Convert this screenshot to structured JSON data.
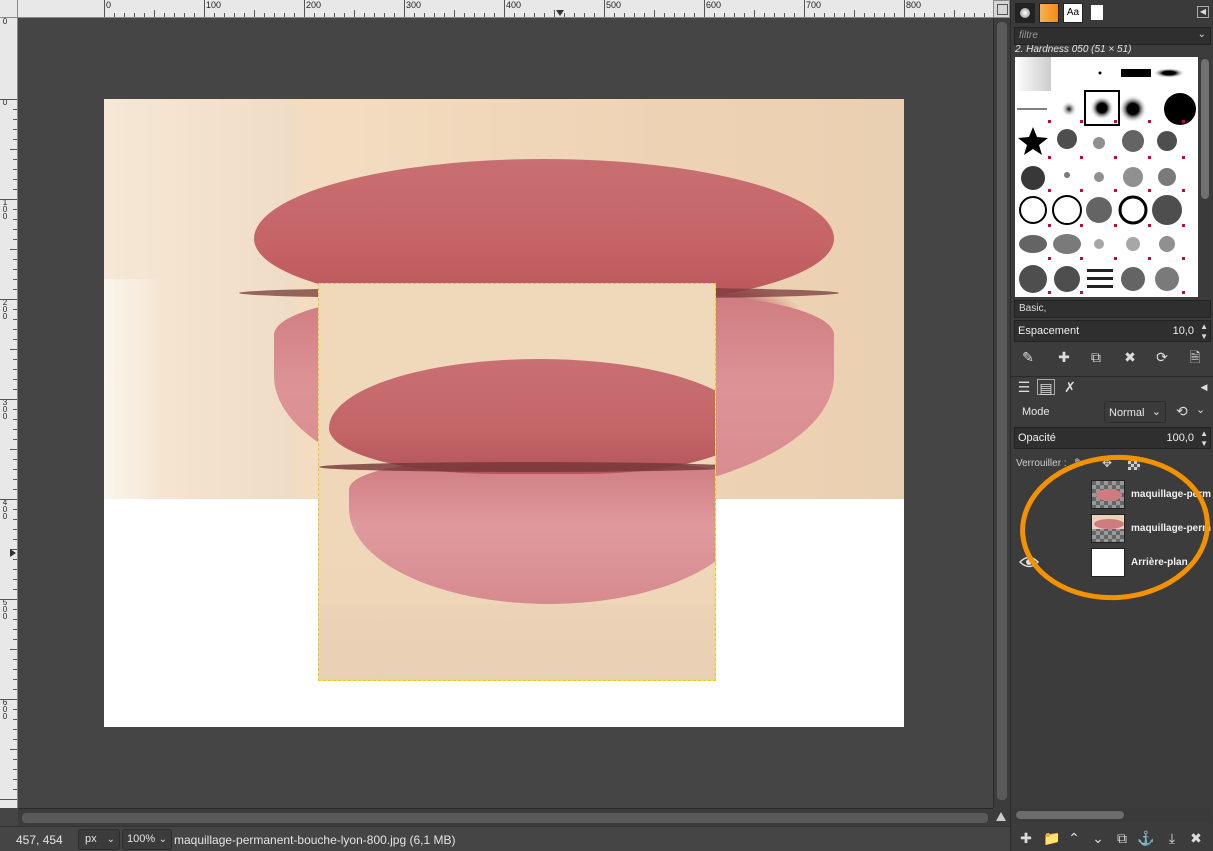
{
  "rulers": {
    "horizontal_labels": [
      "0",
      "100",
      "200",
      "300",
      "400",
      "500",
      "600",
      "700",
      "800"
    ],
    "vertical_labels": [
      "0",
      "0",
      "100",
      "200",
      "300",
      "400",
      "500",
      "600"
    ]
  },
  "status": {
    "coordinates": "457, 454",
    "unit": "px",
    "zoom": "100%",
    "file_info": "maquillage-permanent-bouche-lyon-800.jpg (6,1 MB)"
  },
  "brushes": {
    "filter_placeholder": "filtre",
    "selected_brush": "2. Hardness 050 (51 × 51)",
    "tag": "Basic,",
    "spacing_label": "Espacement",
    "spacing_value": "10,0"
  },
  "layers": {
    "mode_label": "Mode",
    "mode_value": "Normal",
    "opacity_label": "Opacité",
    "opacity_value": "100,0",
    "lock_label": "Verrouiller :",
    "items": [
      {
        "name": "maquillage-perm",
        "visible": false,
        "active": true
      },
      {
        "name": "maquillage-perm",
        "visible": false,
        "active": false
      },
      {
        "name": "Arrière-plan",
        "visible": true,
        "active": false
      }
    ]
  },
  "colors": {
    "annotation": "#f39200",
    "selection_outline": "#e6d200"
  }
}
